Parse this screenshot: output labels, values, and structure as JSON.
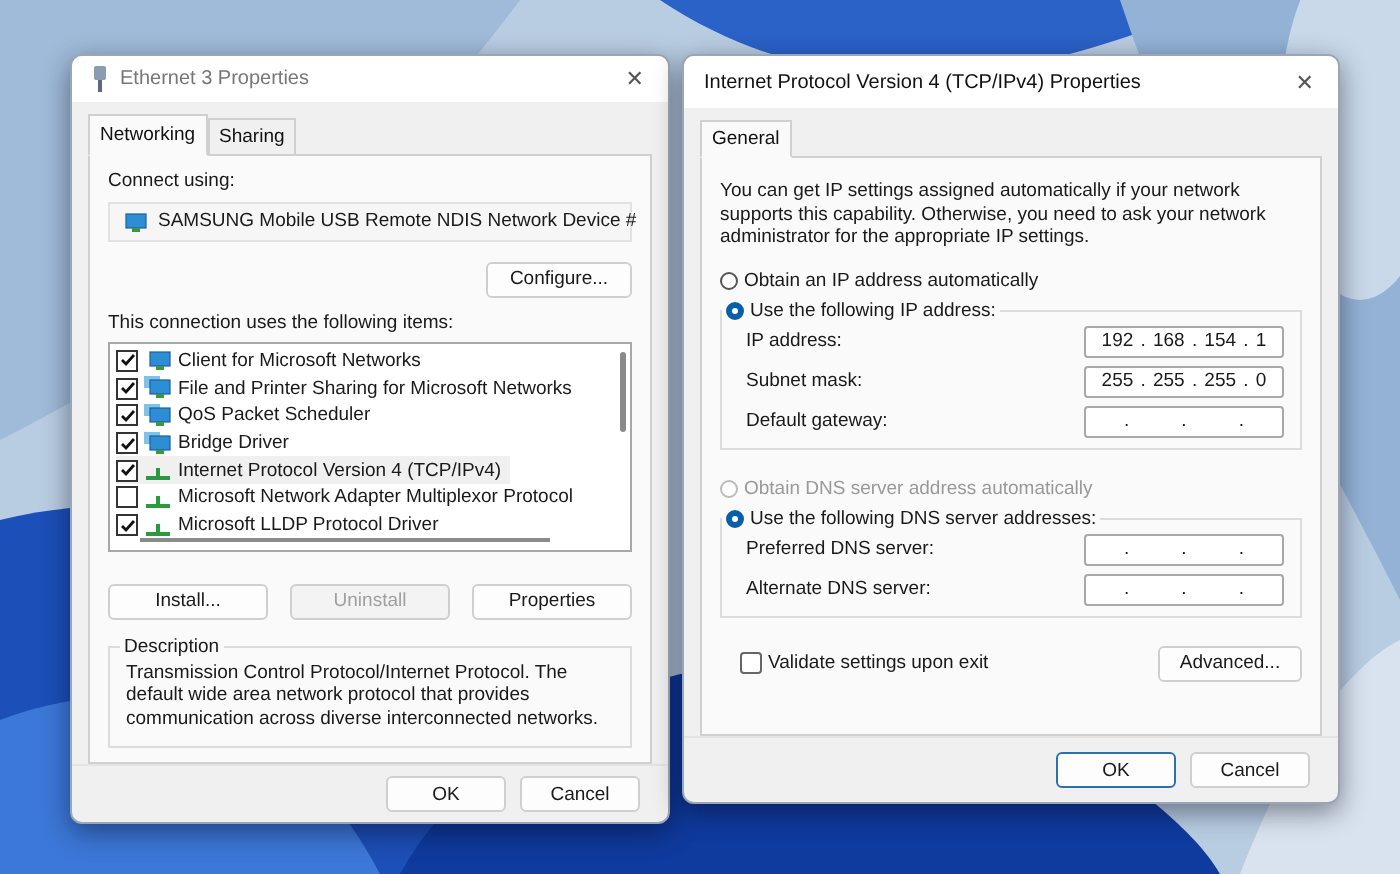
{
  "left_window": {
    "title": "Ethernet 3 Properties",
    "close": "✕",
    "tabs": [
      {
        "label": "Networking",
        "selected": true
      },
      {
        "label": "Sharing",
        "selected": false
      }
    ],
    "connect_using_label": "Connect using:",
    "device": "SAMSUNG Mobile USB Remote NDIS Network Device #",
    "configure_button": "Configure...",
    "items_label": "This connection uses the following items:",
    "items": [
      {
        "label": "Client for Microsoft Networks",
        "checked": true,
        "selected": false,
        "kind": "client"
      },
      {
        "label": "File and Printer Sharing for Microsoft Networks",
        "checked": true,
        "selected": false,
        "kind": "service"
      },
      {
        "label": "QoS Packet Scheduler",
        "checked": true,
        "selected": false,
        "kind": "service"
      },
      {
        "label": "Bridge Driver",
        "checked": true,
        "selected": false,
        "kind": "service"
      },
      {
        "label": "Internet Protocol Version 4 (TCP/IPv4)",
        "checked": true,
        "selected": true,
        "kind": "protocol"
      },
      {
        "label": "Microsoft Network Adapter Multiplexor Protocol",
        "checked": false,
        "selected": false,
        "kind": "protocol"
      },
      {
        "label": "Microsoft LLDP Protocol Driver",
        "checked": true,
        "selected": false,
        "kind": "protocol"
      }
    ],
    "item_buttons": [
      {
        "label": "Install...",
        "disabled": false
      },
      {
        "label": "Uninstall",
        "disabled": true
      },
      {
        "label": "Properties",
        "disabled": false
      }
    ],
    "description": {
      "title": "Description",
      "text": "Transmission Control Protocol/Internet Protocol. The default wide area network protocol that provides communication across diverse interconnected networks."
    },
    "footer_buttons": [
      {
        "label": "OK",
        "default": false
      },
      {
        "label": "Cancel",
        "default": false
      }
    ]
  },
  "right_window": {
    "title": "Internet Protocol Version 4 (TCP/IPv4) Properties",
    "close": "✕",
    "tabs": [
      {
        "label": "General",
        "selected": true
      }
    ],
    "intro": "You can get IP settings assigned automatically if your network supports this capability. Otherwise, you need to ask your network administrator for the appropriate IP settings.",
    "ip_radios": [
      {
        "label": "Obtain an IP address automatically",
        "selected": false,
        "disabled": false
      },
      {
        "label": "Use the following IP address:",
        "selected": true,
        "disabled": false
      }
    ],
    "ip_fields": [
      {
        "label": "IP address:",
        "segments": [
          "192",
          ".",
          "168",
          ".",
          "154",
          ".",
          "1"
        ]
      },
      {
        "label": "Subnet mask:",
        "segments": [
          "255",
          ".",
          "255",
          ".",
          "255",
          ".",
          "0"
        ]
      },
      {
        "label": "Default gateway:",
        "segments": [
          ".",
          ".",
          "."
        ]
      }
    ],
    "dns_radios": [
      {
        "label": "Obtain DNS server address automatically",
        "selected": false,
        "disabled": true
      },
      {
        "label": "Use the following DNS server addresses:",
        "selected": true,
        "disabled": false
      }
    ],
    "dns_fields": [
      {
        "label": "Preferred DNS server:",
        "segments": [
          ".",
          ".",
          "."
        ]
      },
      {
        "label": "Alternate DNS server:",
        "segments": [
          ".",
          ".",
          "."
        ]
      }
    ],
    "validate": {
      "label": "Validate settings upon exit",
      "checked": false
    },
    "advanced_button": "Advanced...",
    "footer_buttons": [
      {
        "label": "OK",
        "default": true
      },
      {
        "label": "Cancel",
        "default": false
      }
    ]
  }
}
